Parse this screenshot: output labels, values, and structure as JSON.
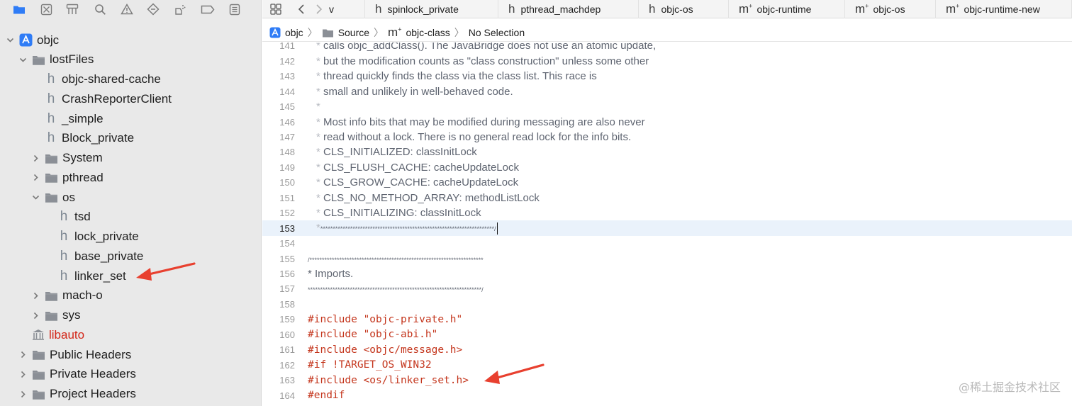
{
  "navigator": {
    "toolbar_icons": [
      "folder-icon",
      "source-control-icon",
      "symbol-hierarchy-icon",
      "find-icon",
      "issue-warning-icon",
      "test-diamond-icon",
      "debug-spray-icon",
      "breakpoint-icon",
      "report-icon"
    ],
    "tree": [
      {
        "label": "objc",
        "kind": "project",
        "chevron": "open"
      },
      {
        "label": "lostFiles",
        "kind": "folder",
        "chevron": "open"
      },
      {
        "label": "objc-shared-cache",
        "kind": "header"
      },
      {
        "label": "CrashReporterClient",
        "kind": "header"
      },
      {
        "label": "_simple",
        "kind": "header"
      },
      {
        "label": "Block_private",
        "kind": "header"
      },
      {
        "label": "System",
        "kind": "folder",
        "chevron": "closed"
      },
      {
        "label": "pthread",
        "kind": "folder",
        "chevron": "closed"
      },
      {
        "label": "os",
        "kind": "folder",
        "chevron": "open"
      },
      {
        "label": "tsd",
        "kind": "header"
      },
      {
        "label": "lock_private",
        "kind": "header"
      },
      {
        "label": "base_private",
        "kind": "header"
      },
      {
        "label": "linker_set",
        "kind": "header"
      },
      {
        "label": "mach-o",
        "kind": "folder",
        "chevron": "closed"
      },
      {
        "label": "sys",
        "kind": "folder",
        "chevron": "closed"
      },
      {
        "label": "libauto",
        "kind": "library"
      },
      {
        "label": "Public Headers",
        "kind": "folder",
        "chevron": "closed"
      },
      {
        "label": "Private Headers",
        "kind": "folder",
        "chevron": "closed"
      },
      {
        "label": "Project Headers",
        "kind": "folder",
        "chevron": "closed"
      }
    ]
  },
  "tabbar": {
    "tabs": [
      {
        "label": "v",
        "icon": ""
      },
      {
        "label": "spinlock_private",
        "icon": "h"
      },
      {
        "label": "pthread_machdep",
        "icon": "h"
      },
      {
        "label": "objc-os",
        "icon": "h"
      },
      {
        "label": "objc-runtime",
        "icon": "m"
      },
      {
        "label": "objc-os",
        "icon": "m"
      },
      {
        "label": "objc-runtime-new",
        "icon": "m"
      }
    ]
  },
  "jumpbar": {
    "project": "objc",
    "folder": "Source",
    "file": "objc-class",
    "selection": "No Selection"
  },
  "editor": {
    "current_line": 153,
    "lines": [
      {
        "n": "141",
        "type": "comment",
        "text": " calls objc_addClass(). The JavaBridge does not use an atomic update,"
      },
      {
        "n": "142",
        "type": "comment",
        "text": " but the modification counts as \"class construction\" unless some other"
      },
      {
        "n": "143",
        "type": "comment",
        "text": " thread quickly finds the class via the class list. This race is"
      },
      {
        "n": "144",
        "type": "comment",
        "text": " small and unlikely in well-behaved code."
      },
      {
        "n": "145",
        "type": "comment",
        "text": ""
      },
      {
        "n": "146",
        "type": "comment",
        "text": " Most info bits that may be modified during messaging are also never"
      },
      {
        "n": "147",
        "type": "comment",
        "text": " read without a lock. There is no general read lock for the info bits."
      },
      {
        "n": "148",
        "type": "comment",
        "text": " CLS_INITIALIZED: classInitLock"
      },
      {
        "n": "149",
        "type": "comment",
        "text": " CLS_FLUSH_CACHE: cacheUpdateLock"
      },
      {
        "n": "150",
        "type": "comment",
        "text": " CLS_GROW_CACHE: cacheUpdateLock"
      },
      {
        "n": "151",
        "type": "comment",
        "text": " CLS_NO_METHOD_ARRAY: methodListLock"
      },
      {
        "n": "152",
        "type": "comment",
        "text": " CLS_INITIALIZING: classInitLock"
      },
      {
        "n": "153",
        "type": "comment-end",
        "text": "**********************************************************************/"
      },
      {
        "n": "154",
        "type": "blank",
        "text": ""
      },
      {
        "n": "155",
        "type": "comment-start",
        "text": "/**********************************************************************"
      },
      {
        "n": "156",
        "type": "plain-comment",
        "text": "* Imports."
      },
      {
        "n": "157",
        "type": "plain-comment",
        "text": "**********************************************************************/"
      },
      {
        "n": "158",
        "type": "blank",
        "text": ""
      },
      {
        "n": "159",
        "type": "pp",
        "text": "#include \"objc-private.h\""
      },
      {
        "n": "160",
        "type": "pp",
        "text": "#include \"objc-abi.h\""
      },
      {
        "n": "161",
        "type": "pp",
        "text": "#include <objc/message.h>"
      },
      {
        "n": "162",
        "type": "pp",
        "text": "#if !TARGET_OS_WIN32"
      },
      {
        "n": "163",
        "type": "pp",
        "text": "#include <os/linker_set.h>"
      },
      {
        "n": "164",
        "type": "pp",
        "text": "#endif"
      }
    ]
  },
  "annotations": {
    "arrow_color": "#e8402f"
  },
  "watermark": "@稀土掘金技术社区",
  "colors": {
    "navigator_bg": "#e9e9e9",
    "accent_blue": "#2f7cf6",
    "library_red": "#d32618",
    "preprocessor": "#c4361d",
    "current_line": "#eaf2fb"
  }
}
